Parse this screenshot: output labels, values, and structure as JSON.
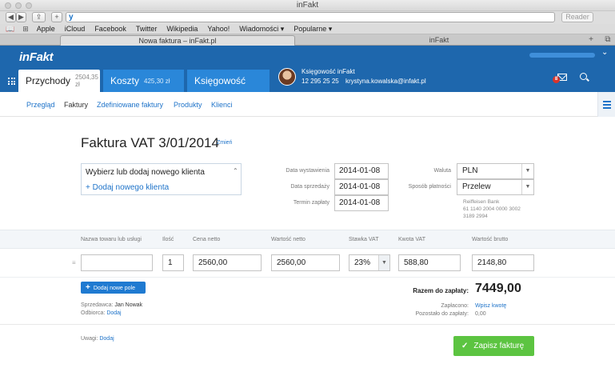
{
  "browser": {
    "window_title": "inFakt",
    "reader_label": "Reader",
    "bookmarks": [
      "Apple",
      "iCloud",
      "Facebook",
      "Twitter",
      "Wikipedia",
      "Yahoo!",
      "Wiadomości ▾",
      "Popularne ▾"
    ],
    "tabs": [
      {
        "label": "Nowa faktura – inFakt.pl",
        "active": true
      },
      {
        "label": "inFakt",
        "active": false
      }
    ]
  },
  "header": {
    "logo": "inFakt",
    "modules": [
      {
        "label": "Przychody",
        "amount": "2504,35 zł"
      },
      {
        "label": "Koszty",
        "amount": "425,30 zł"
      },
      {
        "label": "Księgowość",
        "amount": ""
      }
    ],
    "accountant": {
      "title": "Księgowość inFakt",
      "phone": "12 295 25 25",
      "email": "krystyna.kowalska@infakt.pl"
    },
    "messages_count": "8"
  },
  "subnav": [
    "Przegląd",
    "Faktury",
    "Zdefiniowane faktury",
    "Produkty",
    "Klienci"
  ],
  "invoice": {
    "title": "Faktura VAT 3/01/2014",
    "change_link": "Zmień",
    "client_select": "Wybierz lub dodaj nowego klienta",
    "add_client": "+ Dodaj nowego klienta",
    "dates": [
      {
        "label": "Data wystawienia",
        "value": "2014-01-08"
      },
      {
        "label": "Data sprzedaży",
        "value": "2014-01-08"
      },
      {
        "label": "Termin zapłaty",
        "value": "2014-01-08"
      }
    ],
    "currency_label": "Waluta",
    "currency": "PLN",
    "payment_label": "Sposób płatności",
    "payment": "Przelew",
    "bank": {
      "name": "Reiffeisen Bank",
      "account_line1": "61 1140 2004 0000 3002",
      "account_line2": "3189 2994"
    }
  },
  "items": {
    "headers": [
      "Nazwa towaru lub usługi",
      "Ilość",
      "Cena netto",
      "Wartość netto",
      "Stawka VAT",
      "Kwota VAT",
      "Wartość brutto"
    ],
    "rows": [
      {
        "name": "",
        "qty": "1",
        "net_price": "2560,00",
        "net_value": "2560,00",
        "vat_rate": "23%",
        "vat_amount": "588,80",
        "gross": "2148,80"
      }
    ]
  },
  "summary": {
    "add_field_label": "Dodaj nowe pole",
    "total_label": "Razem do zapłaty:",
    "total_value": "7449,00",
    "paid_label": "Zapłacono:",
    "paid_link": "Wpisz kwotę",
    "remaining_label": "Pozostało do zapłaty:",
    "remaining_value": "0,00",
    "seller_label": "Sprzedawca:",
    "seller_value": "Jan Nowak",
    "recipient_label": "Odbiorca:",
    "recipient_link": "Dodaj"
  },
  "footer": {
    "notes_label": "Uwagi:",
    "notes_link": "Dodaj",
    "save_label": "Zapisz fakturę"
  }
}
